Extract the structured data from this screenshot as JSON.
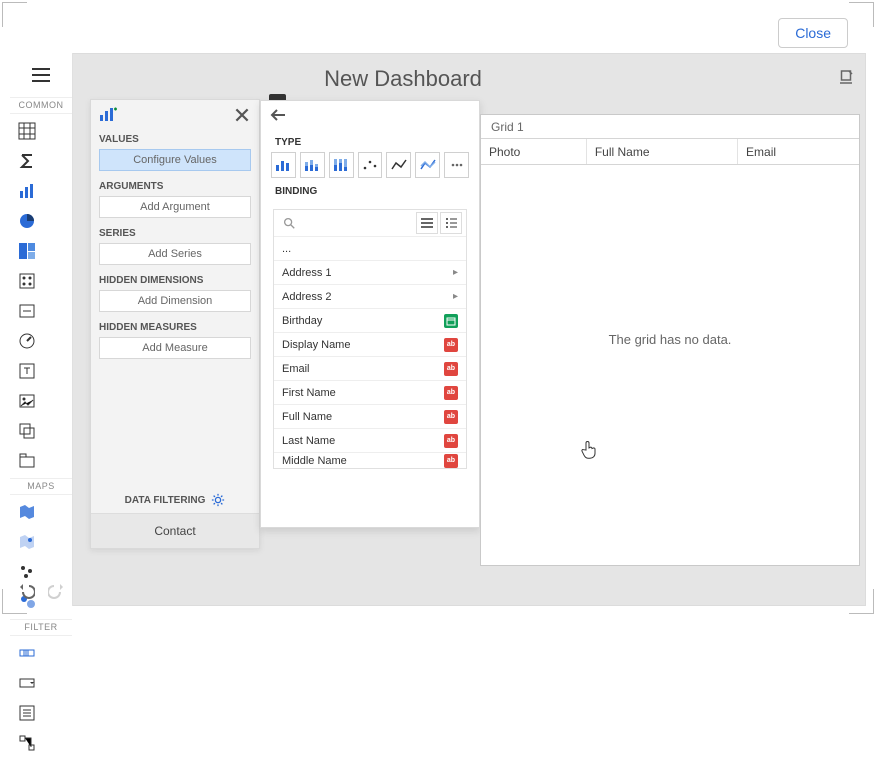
{
  "close_label": "Close",
  "title": "New Dashboard",
  "toolbox": {
    "sections": {
      "common": "COMMON",
      "maps": "MAPS",
      "filter": "FILTER"
    }
  },
  "panel": {
    "values_label": "VALUES",
    "configure_values": "Configure Values",
    "arguments_label": "ARGUMENTS",
    "add_argument": "Add Argument",
    "series_label": "SERIES",
    "add_series": "Add Series",
    "hidden_dimensions_label": "HIDDEN DIMENSIONS",
    "add_dimension": "Add Dimension",
    "hidden_measures_label": "HIDDEN MEASURES",
    "add_measure": "Add Measure",
    "data_filtering": "DATA FILTERING",
    "contact": "Contact"
  },
  "popup": {
    "type_label": "TYPE",
    "binding_label": "BINDING",
    "binding_rows": {
      "r0": "...",
      "r1": "Address 1",
      "r2": "Address 2",
      "r3": "Birthday",
      "r4": "Display Name",
      "r5": "Email",
      "r6": "First Name",
      "r7": "Full Name",
      "r8": "Last Name",
      "r9": "Middle Name"
    }
  },
  "grid": {
    "title": "Grid 1",
    "col1": "Photo",
    "col2": "Full Name",
    "col3": "Email",
    "empty": "The grid has no data."
  }
}
